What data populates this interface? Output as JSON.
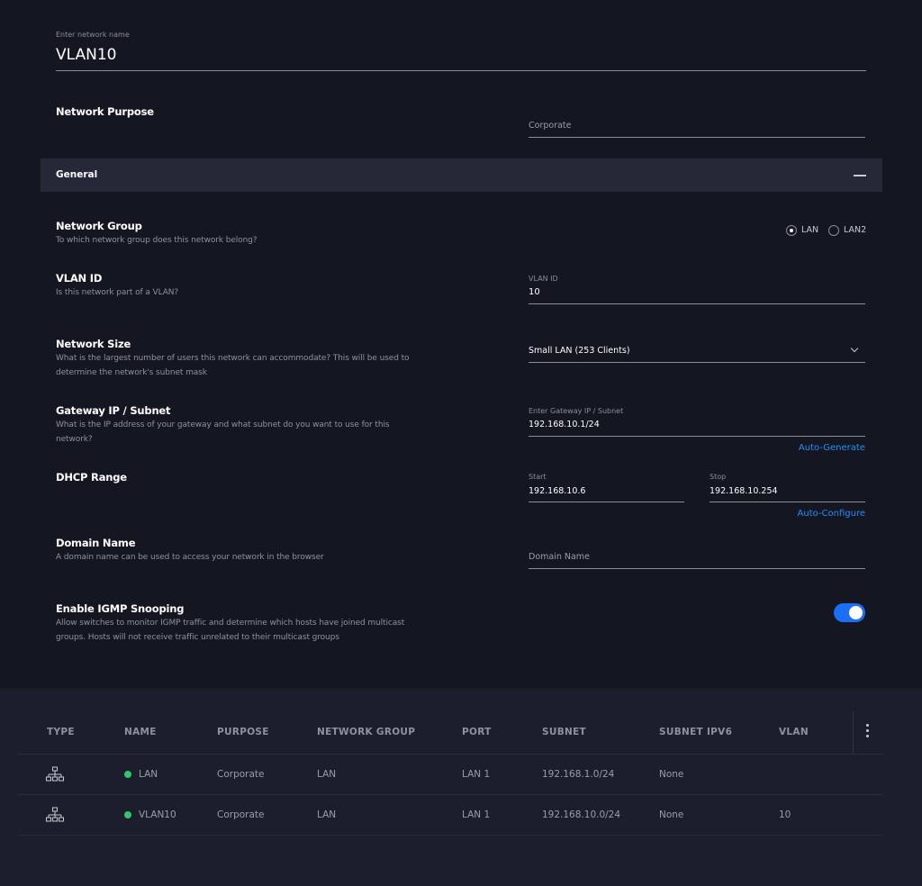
{
  "network_name": {
    "label": "Enter network name",
    "value": "VLAN10"
  },
  "network_purpose": {
    "title": "Network Purpose",
    "value": "Corporate"
  },
  "general_section": {
    "title": "General"
  },
  "network_group": {
    "title": "Network Group",
    "description": "To which network group does this network belong?",
    "options": [
      "LAN",
      "LAN2"
    ],
    "selected": "LAN"
  },
  "vlan_id": {
    "title": "VLAN ID",
    "description": "Is this network part of a VLAN?",
    "field_label": "VLAN ID",
    "value": "10"
  },
  "network_size": {
    "title": "Network Size",
    "description_line1": "What is the largest number of users this network can accommodate? This will be used to",
    "description_line2": "determine the network's subnet mask",
    "selected": "Small LAN (253 Clients)"
  },
  "gateway": {
    "title": "Gateway IP / Subnet",
    "description_line1": "What is the IP address of your gateway and what subnet do you want to use for this",
    "description_line2": "network?",
    "field_label": "Enter Gateway IP / Subnet",
    "value": "192.168.10.1/24",
    "action": "Auto-Generate"
  },
  "dhcp_range": {
    "title": "DHCP Range",
    "start_label": "Start",
    "start_value": "192.168.10.6",
    "stop_label": "Stop",
    "stop_value": "192.168.10.254",
    "action": "Auto-Configure"
  },
  "domain_name": {
    "title": "Domain Name",
    "description": "A domain name can be used to access your network in the browser",
    "placeholder": "Domain Name"
  },
  "igmp": {
    "title": "Enable IGMP Snooping",
    "description_line1": "Allow switches to monitor IGMP traffic and determine which hosts have joined multicast",
    "description_line2": "groups. Hosts will not receive traffic unrelated to their multicast groups",
    "enabled": true
  },
  "table": {
    "headers": [
      "TYPE",
      "NAME",
      "PURPOSE",
      "NETWORK GROUP",
      "PORT",
      "SUBNET",
      "SUBNET IPV6",
      "VLAN"
    ],
    "rows": [
      {
        "type_icon": "network-topology-icon",
        "status_color": "#35c46b",
        "name": "LAN",
        "purpose": "Corporate",
        "network_group": "LAN",
        "port": "LAN 1",
        "subnet": "192.168.1.0/24",
        "subnet_ipv6": "None",
        "vlan": ""
      },
      {
        "type_icon": "network-topology-icon",
        "status_color": "#35c46b",
        "name": "VLAN10",
        "purpose": "Corporate",
        "network_group": "LAN",
        "port": "LAN 1",
        "subnet": "192.168.10.0/24",
        "subnet_ipv6": "None",
        "vlan": "10"
      }
    ]
  },
  "colors": {
    "accent": "#1b6ff5",
    "link": "#1f8fff",
    "status_online": "#35c46b"
  }
}
